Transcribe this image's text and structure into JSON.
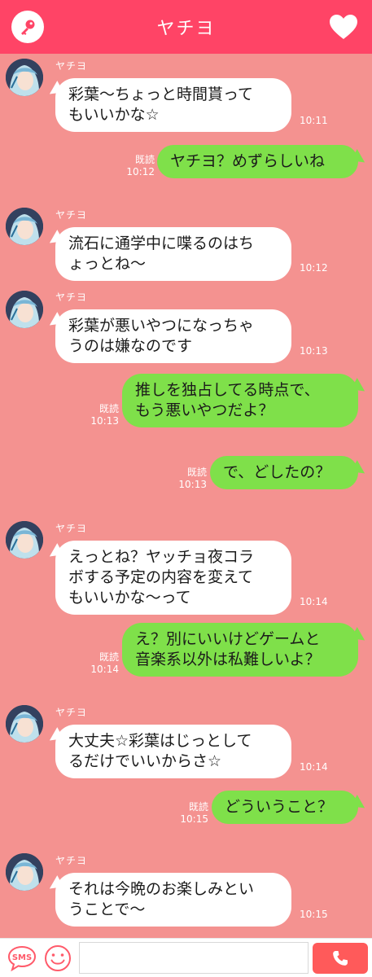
{
  "header": {
    "title": "ヤチヨ",
    "left_icon": "key-icon",
    "right_icon": "heart-icon"
  },
  "colors": {
    "header": "#ff4466",
    "background": "#f49290",
    "incoming_bubble": "#ffffff",
    "outgoing_bubble": "#7fe04a",
    "call_button": "#ff5a5a"
  },
  "messages": [
    {
      "direction": "in",
      "sender": "ヤチヨ",
      "text": "彩葉〜ちょっと時間貰って\nもいいかな☆",
      "time": "10:11"
    },
    {
      "direction": "out",
      "read": "既読",
      "text": "ヤチヨ？めずらしいね",
      "time": "10:12"
    },
    {
      "direction": "in",
      "sender": "ヤチヨ",
      "text": "流石に通学中に喋るのはち\nょっとね〜",
      "time": "10:12"
    },
    {
      "direction": "in",
      "sender": "ヤチヨ",
      "text": "彩葉が悪いやつになっちゃ\nうのは嫌なのです",
      "time": "10:13"
    },
    {
      "direction": "out",
      "read": "既読",
      "text": "推しを独占してる時点で、\nもう悪いやつだよ？",
      "time": "10:13"
    },
    {
      "direction": "out",
      "read": "既読",
      "text": "で、どしたの？",
      "time": "10:13"
    },
    {
      "direction": "in",
      "sender": "ヤチヨ",
      "text": "えっとね？ヤッチョ夜コラ\nボする予定の内容を変えて\nもいいかな〜って",
      "time": "10:14"
    },
    {
      "direction": "out",
      "read": "既読",
      "text": "え？別にいいけどゲームと\n音楽系以外は私難しいよ？",
      "time": "10:14"
    },
    {
      "direction": "in",
      "sender": "ヤチヨ",
      "text": "大丈夫☆彩葉はじっとして\nるだけでいいからさ☆",
      "time": "10:14"
    },
    {
      "direction": "out",
      "read": "既読",
      "text": "どういうこと？",
      "time": "10:15"
    },
    {
      "direction": "in",
      "sender": "ヤチヨ",
      "text": "それは今晩のお楽しみとい\nうことで〜",
      "time": "10:15"
    }
  ],
  "footer": {
    "sms_label": "SMS",
    "smile_icon": "smile-icon",
    "input_value": "",
    "call_icon": "phone-icon"
  }
}
